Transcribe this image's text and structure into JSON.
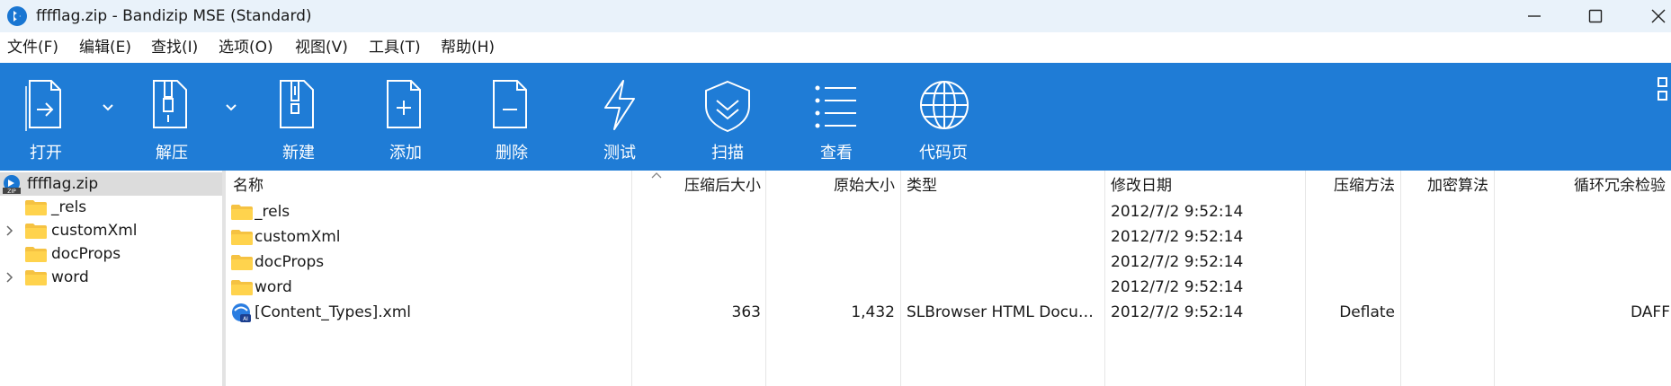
{
  "window": {
    "title": "fffflag.zip - Bandizip MSE (Standard)"
  },
  "menu": [
    "文件(F)",
    "编辑(E)",
    "查找(I)",
    "选项(O)",
    "视图(V)",
    "工具(T)",
    "帮助(H)"
  ],
  "toolbar": {
    "open": "打开",
    "extract": "解压",
    "new": "新建",
    "add": "添加",
    "delete": "删除",
    "test": "测试",
    "scan": "扫描",
    "view": "查看",
    "codepage": "代码页"
  },
  "tree": {
    "root": "fffflag.zip",
    "items": [
      {
        "label": "_rels",
        "expandable": false
      },
      {
        "label": "customXml",
        "expandable": true
      },
      {
        "label": "docProps",
        "expandable": false
      },
      {
        "label": "word",
        "expandable": true
      }
    ]
  },
  "columns": [
    "名称",
    "压缩后大小",
    "原始大小",
    "类型",
    "修改日期",
    "压缩方法",
    "加密算法",
    "循环冗余检验"
  ],
  "files": [
    {
      "name": "_rels",
      "packed": "",
      "size": "",
      "type": "",
      "modified": "2012/7/2 9:52:14",
      "method": "",
      "crc": ""
    },
    {
      "name": "customXml",
      "packed": "",
      "size": "",
      "type": "",
      "modified": "2012/7/2 9:52:14",
      "method": "",
      "crc": ""
    },
    {
      "name": "docProps",
      "packed": "",
      "size": "",
      "type": "",
      "modified": "2012/7/2 9:52:14",
      "method": "",
      "crc": ""
    },
    {
      "name": "word",
      "packed": "",
      "size": "",
      "type": "",
      "modified": "2012/7/2 9:52:14",
      "method": "",
      "crc": ""
    },
    {
      "name": "[Content_Types].xml",
      "packed": "363",
      "size": "1,432",
      "type": "SLBrowser HTML Docu…",
      "modified": "2012/7/2 9:52:14",
      "method": "Deflate",
      "crc": "DAFF"
    }
  ],
  "colors": {
    "toolbar": "#1f7cd6",
    "titlebar": "#e9f2fa",
    "folder": "#f5c242",
    "selection": "#dcdcdc"
  }
}
